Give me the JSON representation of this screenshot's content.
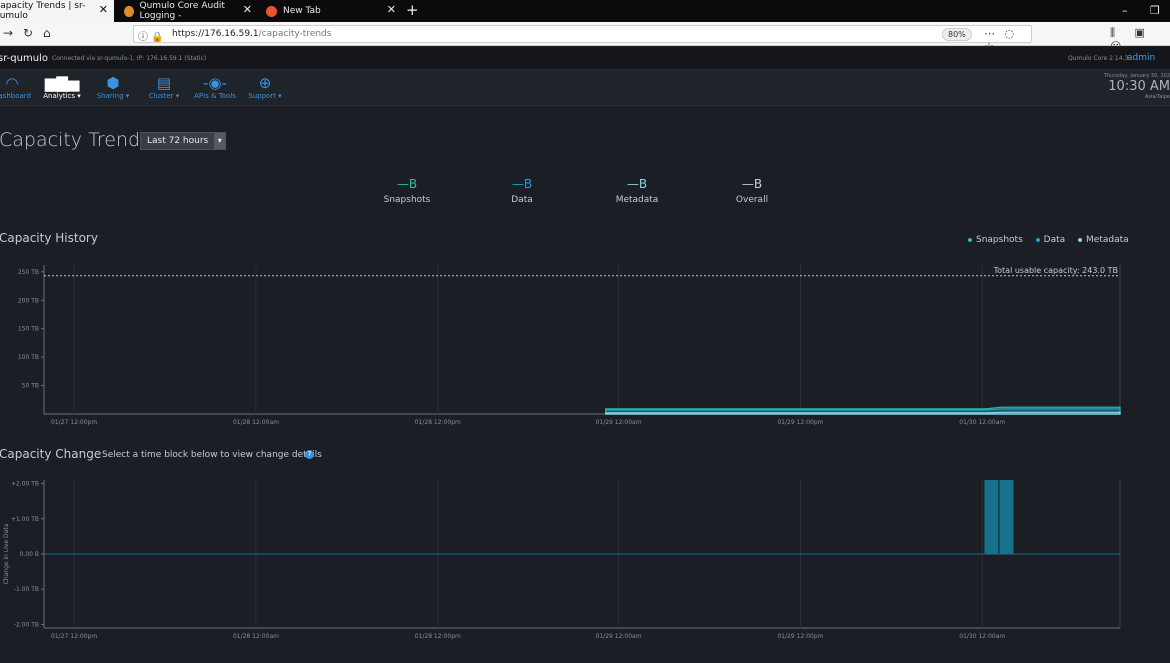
{
  "browser": {
    "tabs": [
      {
        "label": "Capacity Trends | sr-qumulo",
        "close": "✕"
      },
      {
        "label": "Qumulo Core Audit Logging - ",
        "close": "✕"
      },
      {
        "label": "New Tab",
        "close": "✕"
      }
    ],
    "new_tab": "+",
    "url_host": "https://176.16.59.1",
    "url_path": "/capacity-trends",
    "zoom": "80%"
  },
  "header": {
    "cluster_name": "sr-qumulo",
    "connection": "Connected via sr-qumulo-1, IP: 176.16.59.1 (Static)",
    "version": "Qumulo Core 2.14.3",
    "user": "admin"
  },
  "nav": {
    "items": [
      {
        "label": "Dashboard",
        "icon": "gauge-icon"
      },
      {
        "label": "Analytics ▾",
        "icon": "bar-chart-icon"
      },
      {
        "label": "Sharing ▾",
        "icon": "share-icon"
      },
      {
        "label": "Cluster ▾",
        "icon": "server-icon"
      },
      {
        "label": "APIs & Tools",
        "icon": "api-icon"
      },
      {
        "label": "Support ▾",
        "icon": "lifebuoy-icon"
      }
    ],
    "clock": {
      "date": "Thursday, January 30, 202",
      "time": "10:30 AM",
      "tz": "Asia/Taipe"
    }
  },
  "page": {
    "title": "Capacity Trends",
    "range": "Last 72 hours",
    "summary": [
      {
        "label": "Snapshots",
        "value": "—B",
        "color": "#27c2a0"
      },
      {
        "label": "Data",
        "value": "—B",
        "color": "#1e9fd6"
      },
      {
        "label": "Metadata",
        "value": "—B",
        "color": "#8ecfe0"
      },
      {
        "label": "Overall",
        "value": "—B",
        "color": "#c8ccd2"
      }
    ],
    "history_title": "Capacity History",
    "legend": [
      "Snapshots",
      "Data",
      "Metadata"
    ],
    "change_title": "Capacity Change",
    "change_hint": "Select a time block below to view change details",
    "help_icon": "?"
  },
  "chart_data": [
    {
      "type": "area",
      "title": "Capacity History",
      "ylabel": "",
      "y_ticks": [
        "250 TB",
        "200 TB",
        "150 TB",
        "100 TB",
        "50 TB"
      ],
      "ylim": [
        0,
        262
      ],
      "x_ticks": [
        "01/27 12:00pm",
        "01/28 12:00am",
        "01/28 12:00pm",
        "01/29 12:00am",
        "01/29 12:00pm",
        "01/30 12:00am"
      ],
      "annotation": "Total usable capacity: 243.0 TB",
      "reference_line": 243,
      "series": [
        {
          "name": "Snapshots",
          "color": "#27c2a0",
          "x": [
            0.0,
            0.522,
            0.875,
            0.89,
            1.0
          ],
          "values": [
            0,
            9,
            9,
            12,
            12
          ]
        },
        {
          "name": "Data",
          "color": "#1e9fd6",
          "x": [
            0.0,
            0.522,
            0.875,
            0.89,
            1.0
          ],
          "values": [
            0,
            7,
            7,
            9,
            9
          ]
        },
        {
          "name": "Metadata",
          "color": "#8ecfe0",
          "x": [
            0.0,
            0.522,
            0.875,
            0.89,
            1.0
          ],
          "values": [
            0,
            2,
            2,
            3,
            3
          ]
        }
      ],
      "grid": true,
      "legend": "top-right"
    },
    {
      "type": "bar",
      "title": "Capacity Change",
      "ylabel": "Change in Live Data",
      "y_ticks": [
        "+2.00 TB",
        "+1.00 TB",
        "0.00 B",
        "-1.00 TB",
        "-2.00 TB"
      ],
      "ylim": [
        -2.1,
        2.1
      ],
      "x_ticks": [
        "01/27 12:00pm",
        "01/28 12:00am",
        "01/28 12:00pm",
        "01/29 12:00am",
        "01/29 12:00pm",
        "01/30 12:00am"
      ],
      "bars": [
        {
          "x": 0.874,
          "value": 2.2
        },
        {
          "x": 0.888,
          "value": 2.15
        }
      ],
      "color": "#16728c",
      "grid": true
    }
  ]
}
